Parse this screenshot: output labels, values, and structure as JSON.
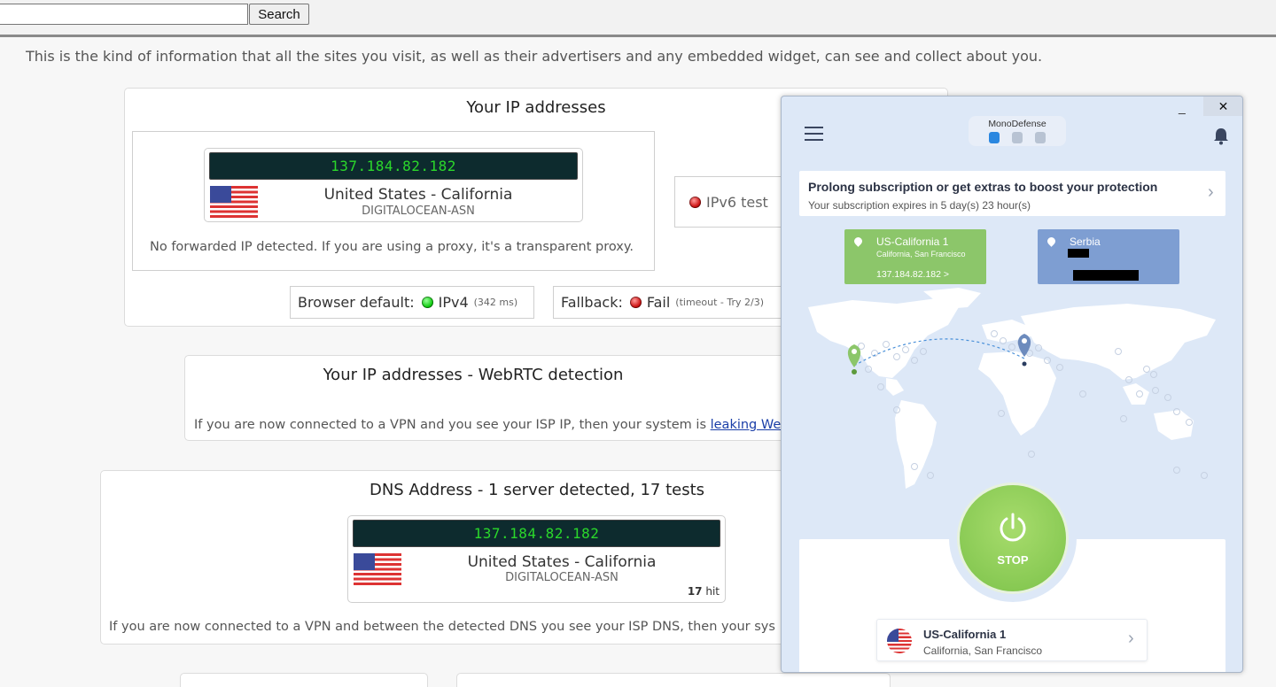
{
  "search": {
    "value": "",
    "button": "Search"
  },
  "intro": "This is the kind of information that all the sites you visit, as well as their advertisers and any embedded widget, can see and collect about you.",
  "ip_panel": {
    "title": "Your IP addresses",
    "ip": "137.184.82.182",
    "location": "United States - California",
    "asn": "DIGITALOCEAN-ASN",
    "forward_note": "No forwarded IP detected. If you are using a proxy, it's a transparent proxy.",
    "ipv6_label": "IPv6 test",
    "browser_default_label": "Browser default:",
    "browser_default_value": "IPv4",
    "browser_default_time": "(342 ms)",
    "fallback_label": "Fallback:",
    "fallback_value": "Fail",
    "fallback_note": "(timeout - Try 2/3)"
  },
  "webrtc_panel": {
    "title": "Your IP addresses - WebRTC detection",
    "note": "If you are now connected to a VPN and you see your ISP IP, then your system is",
    "link": "leaking We"
  },
  "dns_panel": {
    "title": "DNS Address - 1 server detected, 17 tests",
    "ip": "137.184.82.182",
    "location": "United States - California",
    "asn": "DIGITALOCEAN-ASN",
    "hits_count": "17",
    "hits_label": "hit",
    "note": "If you are now connected to a VPN and between the detected DNS you see your ISP DNS, then your sys"
  },
  "vpn": {
    "minimize": "_",
    "close": "✕",
    "brand": "MonoDefense",
    "menu_icon": "hamburger-icon",
    "bell_icon": "bell-icon",
    "banner_title": "Prolong subscription or get extras to boost your protection",
    "banner_sub": "Your subscription expires in 5 day(s) 23 hour(s)",
    "from_card": {
      "name": "US-California 1",
      "sub": "California, San Francisco",
      "ip": "137.184.82.182  >"
    },
    "to_card": {
      "name": "Serbia"
    },
    "stop_label": "STOP",
    "server_name": "US-California 1",
    "server_sub": "California, San Francisco",
    "colors": {
      "accent_green": "#8cc66a",
      "accent_blue": "#7e9ed2",
      "bg": "#dde8f7"
    }
  }
}
